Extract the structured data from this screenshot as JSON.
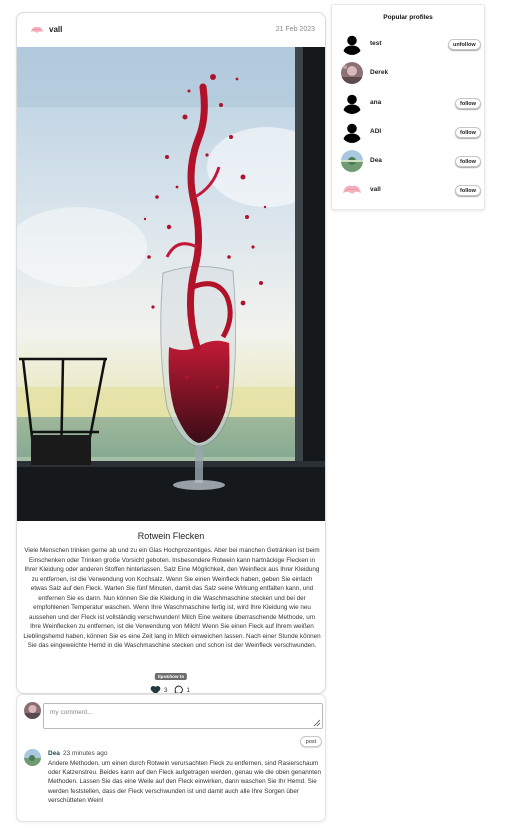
{
  "post": {
    "author": "vall",
    "avatar_icon": "pink-flower-avatar",
    "date": "21 Feb 2023",
    "image_alt": "Red wine splashing into a glass by a window",
    "title": "Rotwein Flecken",
    "body": "Viele Menschen trinken gerne ab und zu ein Glas Hochprozentiges. Aber bei manchen Getränken ist beim Einschenken oder Trinken große Vorsicht geboten. Insbesondere Rotwein kann hartnäckige Flecken in Ihrer Kleidung oder anderen Stoffen hinterlassen. Salz Eine Möglichkeit, den Weinfleck aus Ihrer Kleidung zu entfernen, ist die Verwendung von Kochsalz. Wenn Sie einen Weinfleck haben, geben Sie einfach etwas Salz auf den Fleck. Warten Sie fünf Minuten, damit das Salz seine Wirkung entfalten kann, und entfernen Sie es dann. Nun können Sie die Kleidung in die Waschmaschine stecken und bei der empfohlenen Temperatur waschen. Wenn Ihre Waschmaschine fertig ist, wird Ihre Kleidung wie neu aussehen und der Fleck ist vollständig verschwunden! Milch Eine weitere überraschende Methode, um Ihre Weinflecken zu entfernen, ist die Verwendung von Milch! Wenn Sie einen Fleck auf Ihrem weißen Lieblingshemd haben, können Sie es eine Zeit lang in Milch einweichen lassen. Nach einer Stunde können Sie das eingeweichte Hemd in die Waschmaschine stecken und schon ist der Weinfleck verschwunden.",
    "tag": "tips&how to",
    "likes": "3",
    "comments_count": "1"
  },
  "comment_box": {
    "placeholder": "my comment...",
    "post_label": "post"
  },
  "comments": [
    {
      "author": "Dea",
      "time": "23 minutes ago",
      "text": "Andere Methoden, um einen durch Rotwein verursachten Fleck zu entfernen, sind Rasierschaum oder Katzenstreu. Beides kann auf den Fleck aufgetragen werden, genau wie die oben genannten Methoden. Lassen Sie das eine Weile auf den Fleck einwirken, dann waschen Sie Ihr Hemd. Sie werden feststellen, dass der Fleck verschwunden ist und damit auch alle Ihre Sorgen über verschütteten Wein!"
    }
  ],
  "popular_profiles": {
    "title": "Popular profiles",
    "items": [
      {
        "name": "test",
        "button": "unfollow",
        "avatar": "default-user-icon"
      },
      {
        "name": "Derek",
        "button": "",
        "avatar": "photo-avatar"
      },
      {
        "name": "ana",
        "button": "follow",
        "avatar": "default-user-icon"
      },
      {
        "name": "ADI",
        "button": "follow",
        "avatar": "default-user-icon"
      },
      {
        "name": "Dea",
        "button": "follow",
        "avatar": "landscape-avatar"
      },
      {
        "name": "vall",
        "button": "follow",
        "avatar": "pink-flower-avatar"
      }
    ]
  },
  "colors": {
    "wine_red": "#b0122a",
    "tag_bg": "#6c6c6c",
    "comment_author": "#1c4e55"
  }
}
